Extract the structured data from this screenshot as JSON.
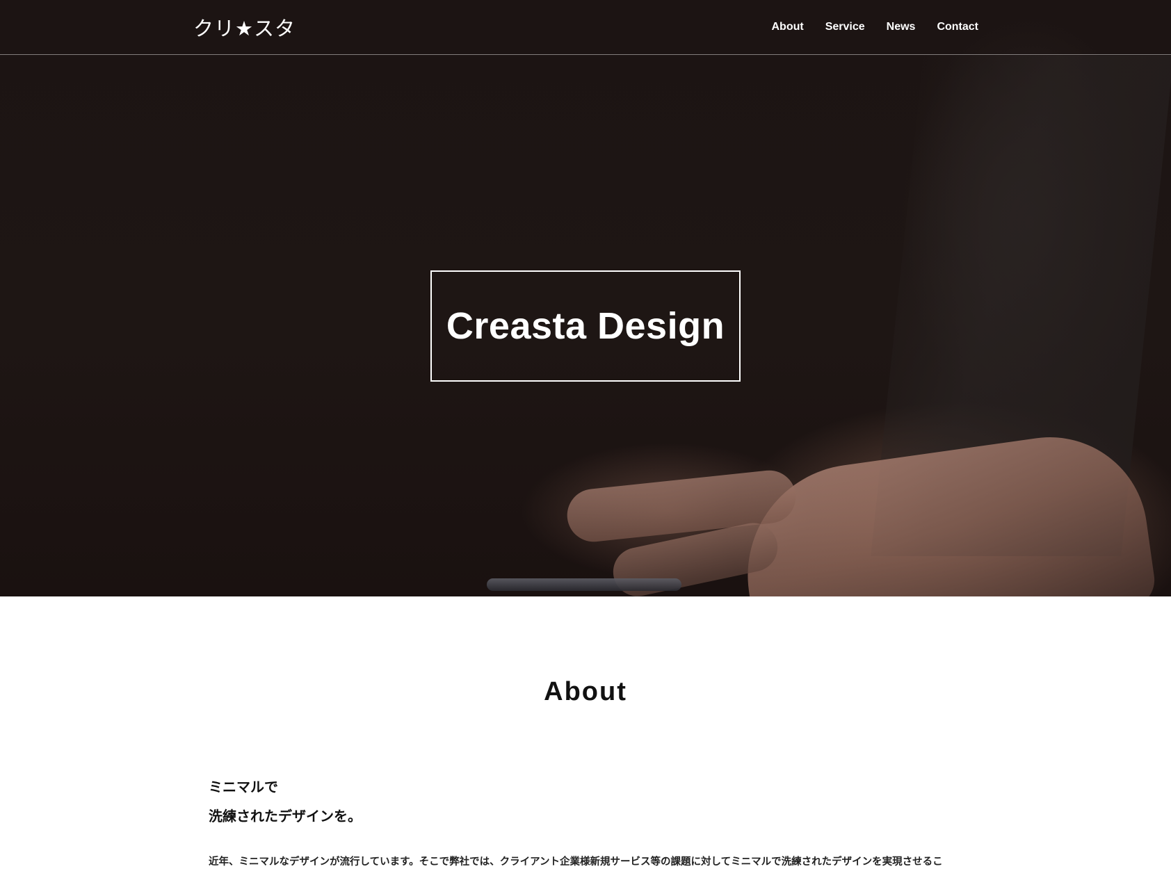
{
  "site": {
    "logo": "クリ★スタ",
    "nav": [
      {
        "label": "About"
      },
      {
        "label": "Service"
      },
      {
        "label": "News"
      },
      {
        "label": "Contact"
      }
    ]
  },
  "hero": {
    "title": "Creasta Design"
  },
  "about": {
    "heading": "About",
    "catch_line_1": "ミニマルで",
    "catch_line_2": "洗練されたデザインを。",
    "body": "近年、ミニマルなデザインが流行しています。そこで弊社では、クライアント企業様新規サービス等の課題に対してミニマルで洗練されたデザインを実現させるこ"
  },
  "colors": {
    "header_bg": "#1c1413",
    "text_light": "#ffffff",
    "text_dark": "#111111",
    "page_bg": "#ffffff"
  }
}
